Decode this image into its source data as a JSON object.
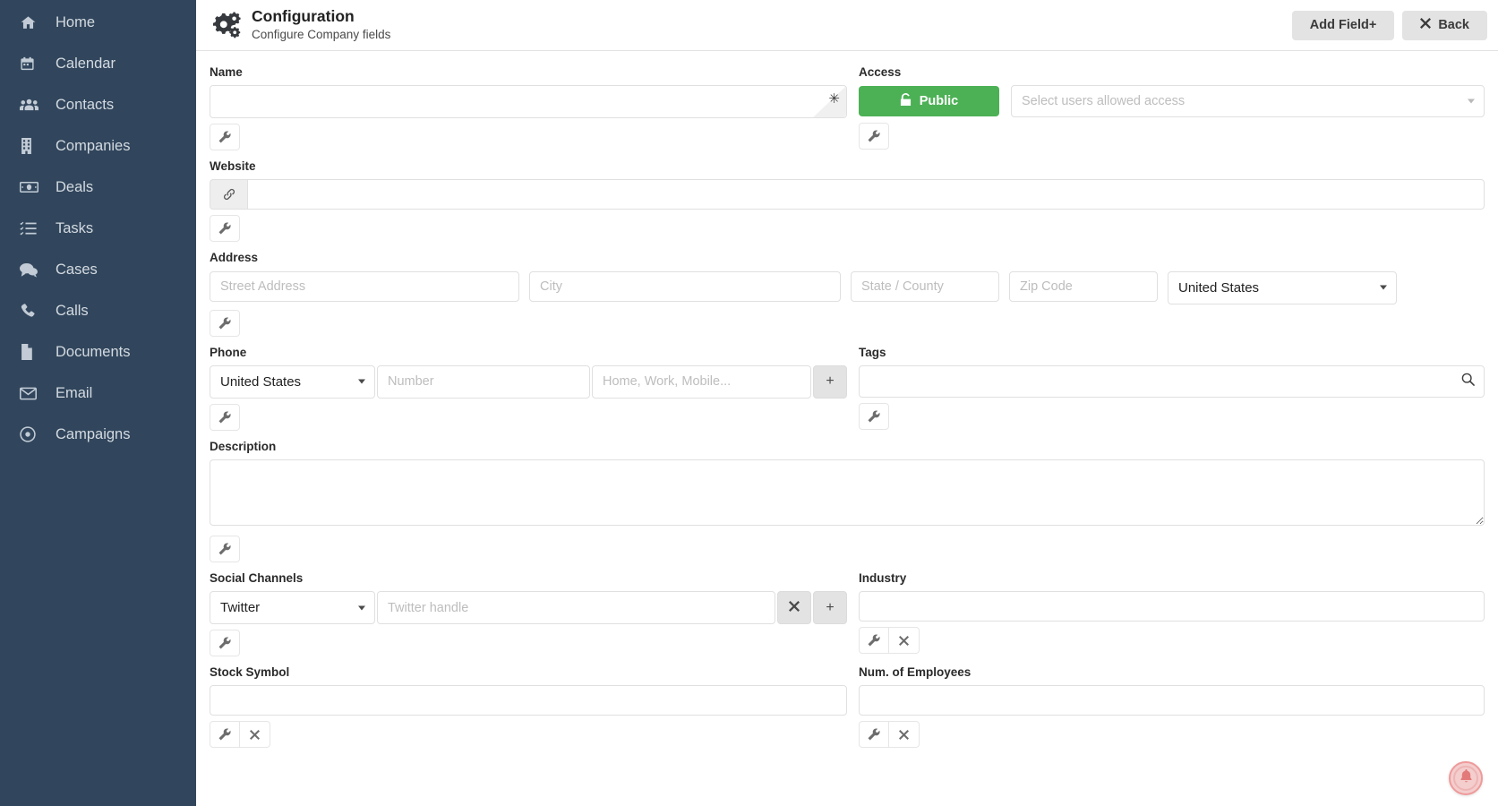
{
  "sidebar": {
    "items": [
      {
        "label": "Home",
        "icon": "home-icon"
      },
      {
        "label": "Calendar",
        "icon": "calendar-icon"
      },
      {
        "label": "Contacts",
        "icon": "contacts-icon"
      },
      {
        "label": "Companies",
        "icon": "building-icon"
      },
      {
        "label": "Deals",
        "icon": "money-icon"
      },
      {
        "label": "Tasks",
        "icon": "tasks-icon"
      },
      {
        "label": "Cases",
        "icon": "chat-icon"
      },
      {
        "label": "Calls",
        "icon": "phone-icon"
      },
      {
        "label": "Documents",
        "icon": "document-icon"
      },
      {
        "label": "Email",
        "icon": "envelope-icon"
      },
      {
        "label": "Campaigns",
        "icon": "target-icon"
      }
    ]
  },
  "header": {
    "icon": "gears-icon",
    "title": "Configuration",
    "subtitle": "Configure Company fields",
    "add_field_label": "Add Field+",
    "back_label": "Back",
    "back_icon": "close-icon"
  },
  "fields": {
    "name": {
      "label": "Name",
      "value": "",
      "placeholder": "",
      "required_marker": "✳"
    },
    "access": {
      "label": "Access",
      "button_label": "Public",
      "button_icon": "unlock-icon",
      "button_color": "#4cb155",
      "select_placeholder": "Select users allowed access",
      "select_value": ""
    },
    "website": {
      "label": "Website",
      "prefix_icon": "link-icon",
      "value": "",
      "placeholder": ""
    },
    "address": {
      "label": "Address",
      "street_placeholder": "Street Address",
      "city_placeholder": "City",
      "state_placeholder": "State / County",
      "zip_placeholder": "Zip Code",
      "country_value": "United States"
    },
    "phone": {
      "label": "Phone",
      "country_value": "United States",
      "number_placeholder": "Number",
      "type_placeholder": "Home, Work, Mobile...",
      "add_label": "+"
    },
    "tags": {
      "label": "Tags",
      "value": "",
      "placeholder": "",
      "search_icon": "search-icon"
    },
    "description": {
      "label": "Description",
      "value": "",
      "placeholder": ""
    },
    "social": {
      "label": "Social Channels",
      "network_value": "Twitter",
      "handle_placeholder": "Twitter handle",
      "remove_label": "✖",
      "add_label": "+"
    },
    "industry": {
      "label": "Industry",
      "value": "",
      "placeholder": ""
    },
    "stock_symbol": {
      "label": "Stock Symbol",
      "value": "",
      "placeholder": ""
    },
    "num_employees": {
      "label": "Num. of Employees",
      "value": "",
      "placeholder": ""
    }
  },
  "tools": {
    "wrench_icon": "wrench-icon",
    "remove_icon": "close-icon"
  },
  "notification": {
    "icon": "bell-icon"
  },
  "colors": {
    "sidebar_bg": "#31465c",
    "accent_green": "#4cb155",
    "notif_pink": "#ef9a9a"
  }
}
